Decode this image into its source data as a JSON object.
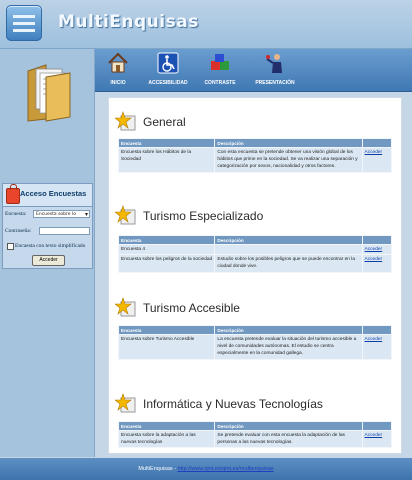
{
  "app": {
    "title": "MultiEnquisas"
  },
  "nav": [
    {
      "label": "INICIO",
      "icon": "home-icon"
    },
    {
      "label": "ACCESIBILIDAD",
      "icon": "wheelchair-icon"
    },
    {
      "label": "CONTRASTE",
      "icon": "contrast-blocks-icon"
    },
    {
      "label": "PRESENTACIÓN",
      "icon": "presenter-icon"
    }
  ],
  "login": {
    "title": "Acceso Encuestas",
    "survey_label": "Encuesta:",
    "survey_value": "Encuesta sobre l​o",
    "password_label": "Contraseña:",
    "password_value": "",
    "simplified_label": "Encuesta con texto simplificado",
    "submit_label": "Acceder"
  },
  "table_headers": {
    "survey": "Encuesta",
    "description": "Descripción"
  },
  "sections": [
    {
      "title": "General",
      "rows": [
        {
          "survey": "Encuesta sobre los Hábitos de la Sociedad",
          "description": "Con esta encuesta se pretende obtener una visión global de los hábitos que prime en la sociedad. Se va realizar una separación y categorización por sexos, nacionalidad y otros factores.",
          "action": "Acceder"
        }
      ]
    },
    {
      "title": "Turismo Especializado",
      "rows": [
        {
          "survey": "Encuesta 4",
          "description": "",
          "action": "Acceder"
        },
        {
          "survey": "Encuesta sobre los peligros de la sociedad",
          "description": "Estudio sobre los posibles peligros que se puede encontrar en la ciudad donde vive.",
          "action": "Acceder"
        }
      ]
    },
    {
      "title": "Turismo Accesible",
      "rows": [
        {
          "survey": "Encuesta sobre Turismo Accesible",
          "description": "La encuesta pretende evaluar la situación del turismo accesible a nivel de comunidades autónomas. El estudio se centra especialmente en la comunidad gallega.",
          "action": "Acceder"
        }
      ]
    },
    {
      "title": "Informática y Nuevas Tecnologías",
      "rows": [
        {
          "survey": "Encuesta sobre la adaptación a las nuevas tecnologías",
          "description": "Se pretende evaluar con esta encuesta la adaptación de las personas a las nuevas tecnologías.",
          "action": "Acceder"
        }
      ]
    }
  ],
  "footer": {
    "prefix": "MultiEnquisas -",
    "url": "http://www.qint.es/qint.es/multienquisas"
  }
}
